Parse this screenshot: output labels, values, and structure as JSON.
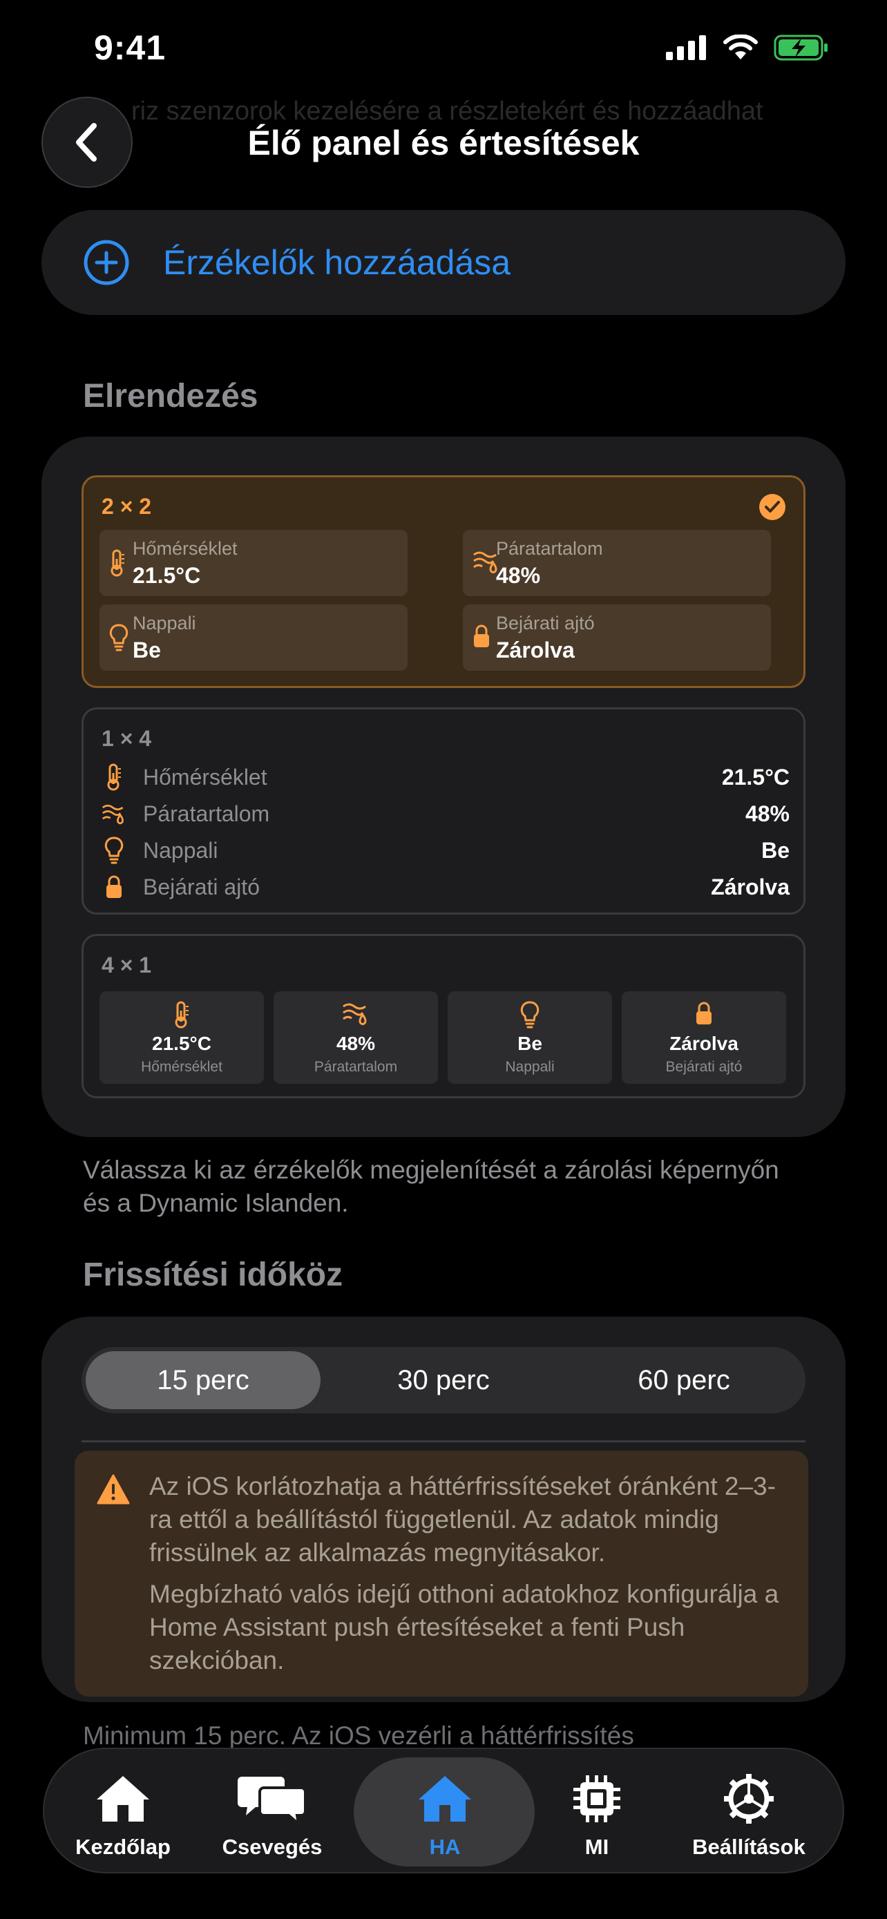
{
  "status": {
    "time": "9:41"
  },
  "header": {
    "title": "Élő panel és értesítések",
    "ghost_text": "riz szenzorok kezelésére a részletekért és hozzáadhat"
  },
  "add_sensors": {
    "label": "Érzékelők hozzáadása"
  },
  "layout_section": {
    "title": "Elrendezés",
    "options": [
      {
        "name": "2 × 2",
        "selected": true,
        "items": [
          {
            "label": "Hőmérséklet",
            "value": "21.5°C",
            "icon": "thermometer-icon"
          },
          {
            "label": "Páratartalom",
            "value": "48%",
            "icon": "humidity-icon"
          },
          {
            "label": "Nappali",
            "value": "Be",
            "icon": "lightbulb-icon"
          },
          {
            "label": "Bejárati ajtó",
            "value": "Zárolva",
            "icon": "lock-icon"
          }
        ]
      },
      {
        "name": "1 × 4",
        "selected": false,
        "items": [
          {
            "label": "Hőmérséklet",
            "value": "21.5°C",
            "icon": "thermometer-icon"
          },
          {
            "label": "Páratartalom",
            "value": "48%",
            "icon": "humidity-icon"
          },
          {
            "label": "Nappali",
            "value": "Be",
            "icon": "lightbulb-icon"
          },
          {
            "label": "Bejárati ajtó",
            "value": "Zárolva",
            "icon": "lock-icon"
          }
        ]
      },
      {
        "name": "4 × 1",
        "selected": false,
        "items": [
          {
            "label": "Hőmérséklet",
            "value": "21.5°C",
            "icon": "thermometer-icon"
          },
          {
            "label": "Páratartalom",
            "value": "48%",
            "icon": "humidity-icon"
          },
          {
            "label": "Nappali",
            "value": "Be",
            "icon": "lightbulb-icon"
          },
          {
            "label": "Bejárati ajtó",
            "value": "Zárolva",
            "icon": "lock-icon"
          }
        ]
      }
    ],
    "footnote": "Válassza ki az érzékelők megjelenítését a zárolási képernyőn és a Dynamic Islanden."
  },
  "refresh_section": {
    "title": "Frissítési időköz",
    "segments": [
      "15 perc",
      "30 perc",
      "60 perc"
    ],
    "selected": "15 perc",
    "warning_p1": "Az iOS korlátozhatja a háttérfrissítéseket óránként 2–3-ra ettől a beállítástól függetlenül. Az adatok mindig frissülnek az alkalmazás megnyitásakor.",
    "warning_p2": "Megbízható valós idejű otthoni adatokhoz konfigurálja a Home Assistant push értesítéseket a fenti Push szekcióban.",
    "footnote": "Minimum 15 perc. Az iOS vezérli a háttérfrissítés"
  },
  "tabbar": {
    "items": [
      {
        "label": "Kezdőlap",
        "icon": "house-icon"
      },
      {
        "label": "Csevegés",
        "icon": "chat-bubbles-icon"
      },
      {
        "label": "HA",
        "icon": "home-assistant-icon",
        "active": true
      },
      {
        "label": "MI",
        "icon": "chip-icon"
      },
      {
        "label": "Beállítások",
        "icon": "gear-icon"
      }
    ]
  },
  "colors": {
    "accent_blue": "#2f8ef3",
    "accent_orange": "#ff9f43",
    "background": "#000000",
    "card": "#1c1c1e"
  }
}
